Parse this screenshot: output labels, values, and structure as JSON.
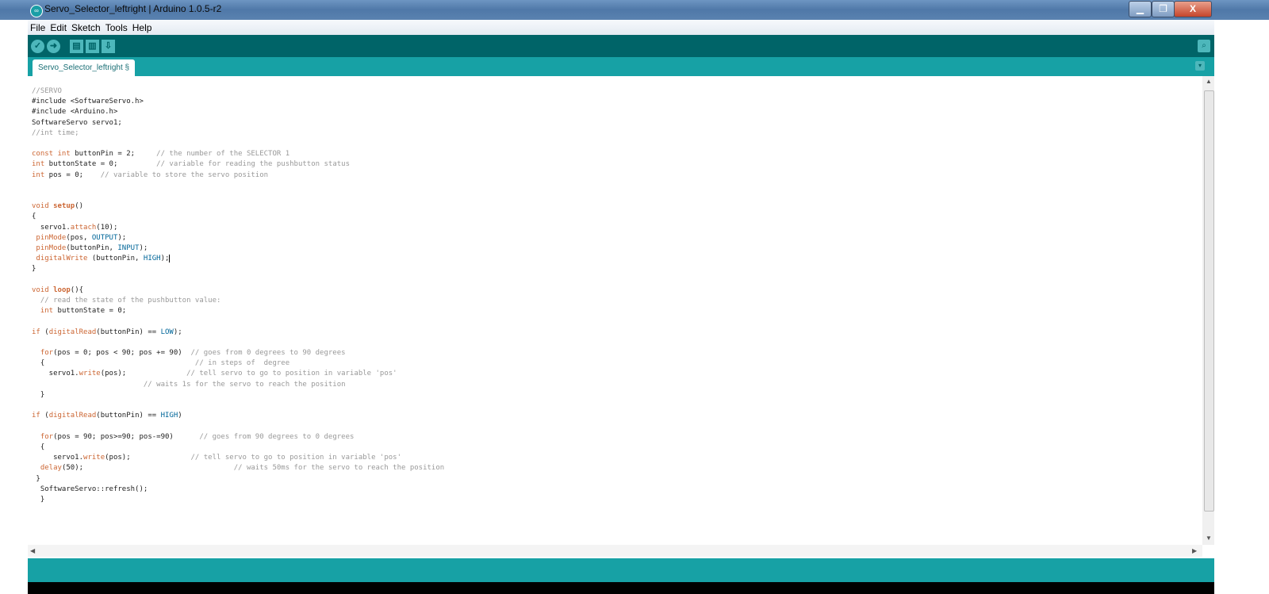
{
  "window": {
    "title": "Servo_Selector_leftright | Arduino 1.0.5-r2",
    "app_icon": "arduino-icon",
    "controls": {
      "minimize": "▁",
      "maximize": "❐",
      "close": "X"
    }
  },
  "menu": [
    "File",
    "Edit",
    "Sketch",
    "Tools",
    "Help"
  ],
  "toolbar": {
    "buttons": [
      "verify-icon",
      "upload-icon",
      "new-icon",
      "open-icon",
      "save-icon"
    ],
    "glyphs": {
      "verify": "✓",
      "upload": "➜",
      "new": "▤",
      "open": "▥",
      "save": "⇩"
    },
    "serial_monitor_glyph": "⌕"
  },
  "tab": {
    "label": "Servo_Selector_leftright §",
    "menu_glyph": "▾"
  },
  "colors": {
    "toolbar": "#006468",
    "tabbar": "#17a1a5",
    "keyword": "#cc6633",
    "comment": "#999999",
    "constant": "#006699"
  },
  "code": [
    [
      [
        "c",
        "//SERVO"
      ]
    ],
    [
      [
        "",
        "#include <SoftwareServo.h>"
      ]
    ],
    [
      [
        "",
        "#include <Arduino.h>"
      ]
    ],
    [
      [
        "",
        "SoftwareServo servo1;"
      ]
    ],
    [
      [
        "c",
        "//int time;"
      ]
    ],
    [],
    [
      [
        "k",
        "const"
      ],
      [
        "",
        ""
      ],
      [
        "k",
        " int"
      ],
      [
        "",
        " buttonPin = 2;     "
      ],
      [
        "c",
        "// the number of the SELECTOR 1"
      ]
    ],
    [
      [
        "k",
        "int"
      ],
      [
        "",
        " buttonState = 0;         "
      ],
      [
        "c",
        "// variable for reading the pushbutton status"
      ]
    ],
    [
      [
        "k",
        "int"
      ],
      [
        "",
        " pos = 0;    "
      ],
      [
        "c",
        "// variable to store the servo position"
      ]
    ],
    [],
    [],
    [
      [
        "k",
        "void"
      ],
      [
        "",
        " "
      ],
      [
        "b",
        "setup"
      ],
      [
        "",
        "()"
      ]
    ],
    [
      [
        "",
        "{"
      ]
    ],
    [
      [
        "",
        "  servo1."
      ],
      [
        "f",
        "attach"
      ],
      [
        "",
        "(10);"
      ]
    ],
    [
      [
        "",
        " "
      ],
      [
        "f",
        "pinMode"
      ],
      [
        "",
        "(pos, "
      ],
      [
        "cn",
        "OUTPUT"
      ],
      [
        "",
        ");"
      ]
    ],
    [
      [
        "",
        " "
      ],
      [
        "f",
        "pinMode"
      ],
      [
        "",
        "(buttonPin, "
      ],
      [
        "cn",
        "INPUT"
      ],
      [
        "",
        ");"
      ]
    ],
    [
      [
        "",
        " "
      ],
      [
        "f",
        "digitalWrite"
      ],
      [
        "",
        " (buttonPin, "
      ],
      [
        "cn",
        "HIGH"
      ],
      [
        "",
        ");"
      ],
      [
        "caret",
        ""
      ]
    ],
    [
      [
        "",
        "}"
      ]
    ],
    [],
    [
      [
        "k",
        "void"
      ],
      [
        "",
        " "
      ],
      [
        "b",
        "loop"
      ],
      [
        "",
        "(){"
      ]
    ],
    [
      [
        "",
        "  "
      ],
      [
        "c",
        "// read the state of the pushbutton value:"
      ]
    ],
    [
      [
        "",
        "  "
      ],
      [
        "k",
        "int"
      ],
      [
        "",
        " buttonState = 0;"
      ]
    ],
    [],
    [
      [
        "k",
        "if"
      ],
      [
        "",
        " ("
      ],
      [
        "f",
        "digitalRead"
      ],
      [
        "",
        "(buttonPin) == "
      ],
      [
        "cn",
        "LOW"
      ],
      [
        "",
        ");"
      ]
    ],
    [],
    [
      [
        "",
        "  "
      ],
      [
        "k",
        "for"
      ],
      [
        "",
        "(pos = 0; pos < 90; pos += 90)  "
      ],
      [
        "c",
        "// goes from 0 degrees to 90 degrees"
      ]
    ],
    [
      [
        "",
        "  {                                   "
      ],
      [
        "c",
        "// in steps of  degree"
      ]
    ],
    [
      [
        "",
        "    servo1."
      ],
      [
        "f",
        "write"
      ],
      [
        "",
        "(pos);              "
      ],
      [
        "c",
        "// tell servo to go to position in variable 'pos'"
      ]
    ],
    [
      [
        "",
        "                          "
      ],
      [
        "c",
        "// waits 1s for the servo to reach the position"
      ]
    ],
    [
      [
        "",
        "  }"
      ]
    ],
    [],
    [
      [
        "k",
        "if"
      ],
      [
        "",
        " ("
      ],
      [
        "f",
        "digitalRead"
      ],
      [
        "",
        "(buttonPin) == "
      ],
      [
        "cn",
        "HIGH"
      ],
      [
        "",
        ")"
      ]
    ],
    [],
    [
      [
        "",
        "  "
      ],
      [
        "k",
        "for"
      ],
      [
        "",
        "(pos = 90; pos>=90; pos-=90)      "
      ],
      [
        "c",
        "// goes from 90 degrees to 0 degrees"
      ]
    ],
    [
      [
        "",
        "  {"
      ]
    ],
    [
      [
        "",
        "     servo1."
      ],
      [
        "f",
        "write"
      ],
      [
        "",
        "(pos);              "
      ],
      [
        "c",
        "// tell servo to go to position in variable 'pos'"
      ]
    ],
    [
      [
        "",
        "  "
      ],
      [
        "f",
        "delay"
      ],
      [
        "",
        "(50);                                   "
      ],
      [
        "c",
        "// waits 50ms for the servo to reach the position"
      ]
    ],
    [
      [
        "",
        " }"
      ]
    ],
    [
      [
        "",
        "  SoftwareServo::refresh();"
      ]
    ],
    [
      [
        "",
        "  }"
      ]
    ]
  ]
}
